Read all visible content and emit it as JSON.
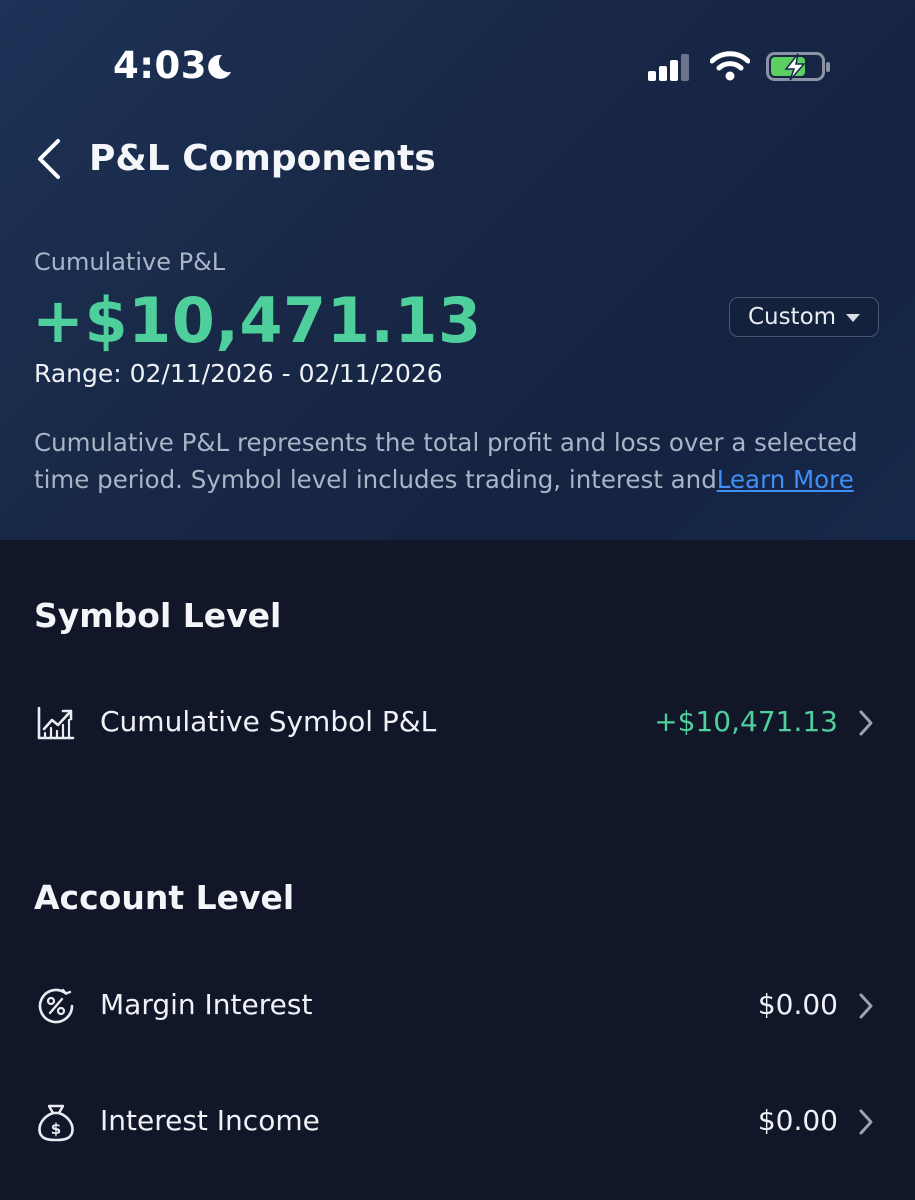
{
  "status": {
    "time": "4:03"
  },
  "header": {
    "title": "P&L Components"
  },
  "summary": {
    "label": "Cumulative P&L",
    "value": "+$10,471.13",
    "range": "Range: 02/11/2026 - 02/11/2026",
    "period_selector": "Custom",
    "description": "Cumulative P&L represents the total profit and loss over a selected time period. Symbol level includes trading, interest and",
    "learn_more": "Learn More"
  },
  "symbol_level": {
    "title": "Symbol Level",
    "rows": [
      {
        "label": "Cumulative Symbol P&L",
        "value": "+$10,471.13",
        "icon": "chart-trend-icon"
      }
    ]
  },
  "account_level": {
    "title": "Account Level",
    "rows": [
      {
        "label": "Margin Interest",
        "value": "$0.00",
        "icon": "percent-icon"
      },
      {
        "label": "Interest Income",
        "value": "$0.00",
        "icon": "money-bag-icon"
      }
    ]
  },
  "colors": {
    "positive": "#4fcf9b",
    "link": "#3f8ff5",
    "background": "#111728"
  }
}
